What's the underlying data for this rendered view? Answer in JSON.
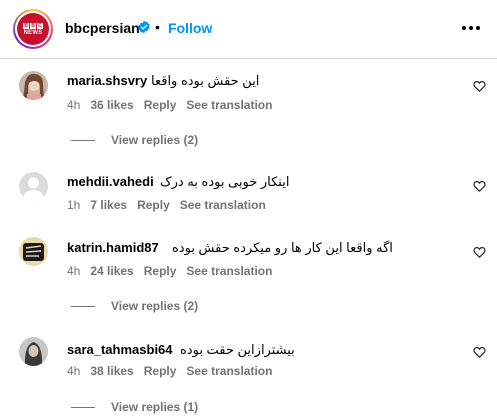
{
  "post": {
    "username": "bbcpersian",
    "separator": "•",
    "follow_label": "Follow",
    "avatar_logo": {
      "letters": [
        "B",
        "B",
        "C"
      ],
      "word": "NEWS"
    },
    "colors": {
      "follow": "#0095f6",
      "brand": "#c8102e",
      "muted": "#737373"
    }
  },
  "comments": [
    {
      "username": "maria.shsvry",
      "text": "این حقش بوده واقعا",
      "time": "4h",
      "likes": "36 likes",
      "reply": "Reply",
      "translate": "See translation",
      "replies": "View replies (2)"
    },
    {
      "username": "mehdii.vahedi",
      "text": "اینکار خوبی بوده به درک",
      "time": "1h",
      "likes": "7 likes",
      "reply": "Reply",
      "translate": "See translation"
    },
    {
      "username": "katrin.hamid87",
      "text": "اگه واقعا این کار ها رو میکرده حقش بوده",
      "time": "4h",
      "likes": "24 likes",
      "reply": "Reply",
      "translate": "See translation",
      "replies": "View replies (2)"
    },
    {
      "username": "sara_tahmasbi64",
      "text": "بیشترازاین حقت بوده",
      "time": "4h",
      "likes": "38 likes",
      "reply": "Reply",
      "translate": "See translation",
      "replies": "View replies (1)"
    }
  ]
}
